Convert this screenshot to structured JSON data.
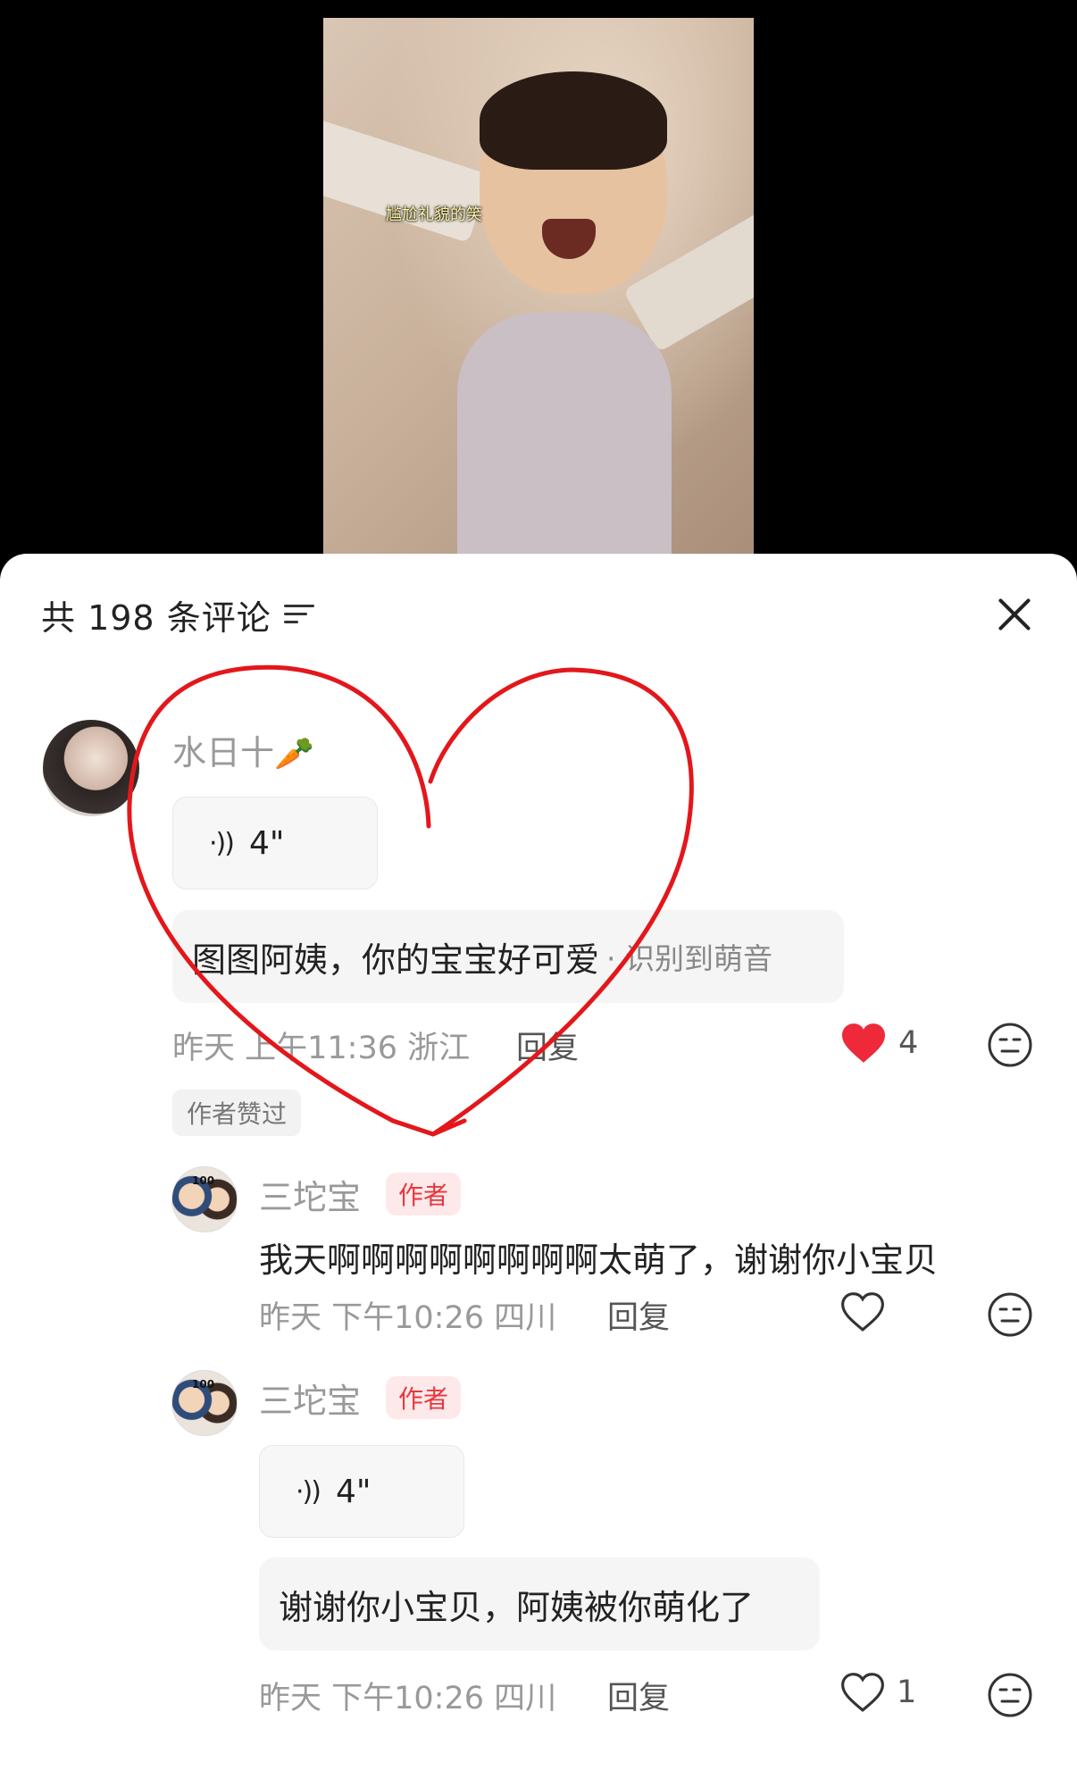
{
  "video": {
    "caption": "尴尬礼貌的笑"
  },
  "sheet": {
    "title": "共 198 条评论",
    "close_label": "×"
  },
  "comments": [
    {
      "username": "水日十",
      "emoji": "🥕",
      "voice_length": "4\"",
      "text": "图图阿姨，你的宝宝好可爱",
      "recognition": "· 识别到萌音",
      "meta": "昨天 上午11:36 浙江",
      "reply_label": "回复",
      "likes": "4",
      "liked": true,
      "author_liked_tag": "作者赞过"
    }
  ],
  "replies": [
    {
      "username": "三坨宝",
      "badge": "作者",
      "avatar_text": "100",
      "text": "我天啊啊啊啊啊啊啊啊太萌了，谢谢你小宝贝",
      "meta": "昨天 下午10:26 四川",
      "reply_label": "回复",
      "likes": ""
    },
    {
      "username": "三坨宝",
      "badge": "作者",
      "avatar_text": "100",
      "voice_length": "4\"",
      "text": "谢谢你小宝贝，阿姨被你萌化了",
      "meta": "昨天 下午10:26 四川",
      "reply_label": "回复",
      "likes": "1"
    }
  ],
  "colors": {
    "heart_annotation": "#e3171b",
    "like_red": "#ee2a3a",
    "author_badge_bg": "#fde9ea",
    "author_badge_text": "#e8373d"
  }
}
